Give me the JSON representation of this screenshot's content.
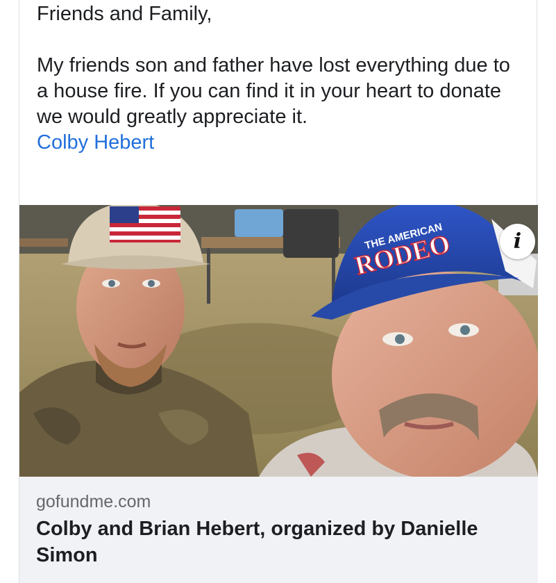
{
  "post": {
    "greeting": "Friends and Family,",
    "body": "My friends son and father have lost everything due to a house fire. If you can find it in your heart to donate we would greatly appreciate it.",
    "mention": "Colby Hebert"
  },
  "photo": {
    "alt": "Two men taking a selfie outdoors; younger man in camo shirt and American flag cap, older man in blue cap",
    "left_cap_patch": "American flag",
    "right_cap_top_text": "THE AMERICAN",
    "right_cap_main_text": "RODEO",
    "info_glyph": "i"
  },
  "link_preview": {
    "domain": "gofundme.com",
    "title": "Colby and Brian Hebert, organized by Danielle Simon"
  },
  "colors": {
    "text": "#1c1e21",
    "link": "#216fdb",
    "secondary_text": "#65676b",
    "preview_bg": "#f0f2f5"
  }
}
